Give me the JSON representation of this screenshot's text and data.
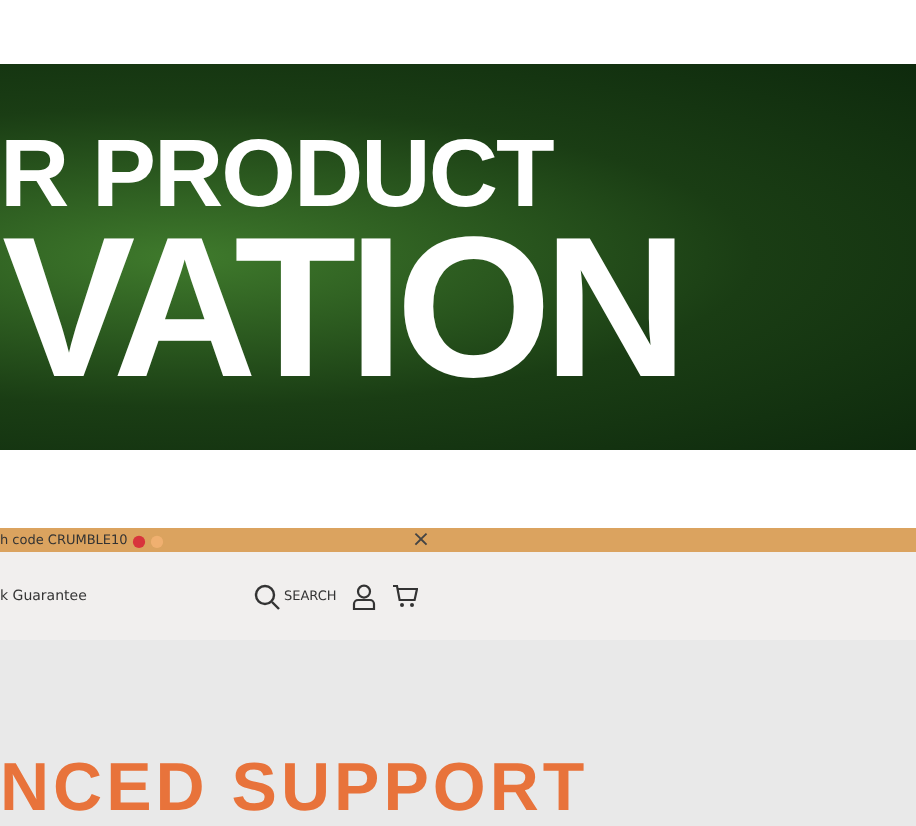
{
  "hero": {
    "line_1": "R PRODUCT",
    "line_2": "VATION"
  },
  "announcement": {
    "text": "h code CRUMBLE10",
    "close": "×"
  },
  "nav": {
    "guarantee": "k Guarantee",
    "search": "SEARCH"
  },
  "section": {
    "heading": "NCED SUPPORT"
  }
}
